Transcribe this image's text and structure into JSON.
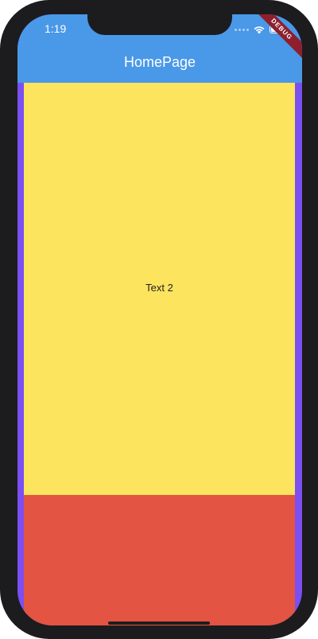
{
  "status_bar": {
    "time": "1:19"
  },
  "app_bar": {
    "title": "HomePage",
    "color": "#4a98e8"
  },
  "debug_banner": {
    "label": "DEBUG"
  },
  "body": {
    "text": "Text 2",
    "side_color": "#7b4ff2",
    "top_color": "#fce45f",
    "bottom_color": "#e35442"
  },
  "icons": [
    "signal-dots-icon",
    "wifi-icon",
    "battery-icon"
  ]
}
